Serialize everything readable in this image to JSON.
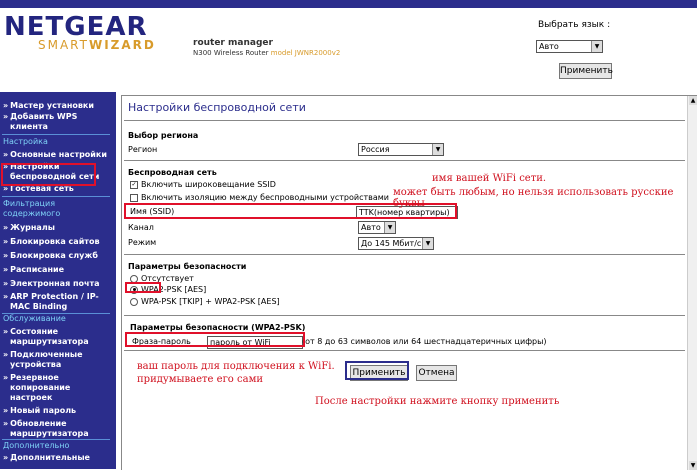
{
  "header": {
    "logo_top": "NETGEAR",
    "logo_smart": "SMART",
    "logo_wizard": "WIZARD",
    "router_manager": "router manager",
    "model_line": "N300 Wireless Router",
    "model_name": "model JWNR2000v2",
    "language_label": "Выбрать язык :",
    "language_value": "Авто",
    "apply_lang_button": "Применить"
  },
  "sidebar": {
    "items": [
      {
        "label": "Мастер установки"
      },
      {
        "label": "Добавить WPS"
      },
      {
        "label": "клиента"
      },
      {
        "label": "Настройка"
      },
      {
        "label": "Основные настройки"
      },
      {
        "label": "Настройки"
      },
      {
        "label": "беспроводной сети"
      },
      {
        "label": "Гостевая сеть"
      },
      {
        "label": "Фильтрация"
      },
      {
        "label": "содержимого"
      },
      {
        "label": "Журналы"
      },
      {
        "label": "Блокировка сайтов"
      },
      {
        "label": "Блокировка служб"
      },
      {
        "label": "Расписание"
      },
      {
        "label": "Электронная почта"
      },
      {
        "label": "ARP Protection / IP-"
      },
      {
        "label": "MAC Binding"
      },
      {
        "label": "Обслуживание"
      },
      {
        "label": "Состояние"
      },
      {
        "label": "маршрутизатора"
      },
      {
        "label": "Подключенные"
      },
      {
        "label": "устройства"
      },
      {
        "label": "Резервное"
      },
      {
        "label": "копирование"
      },
      {
        "label": "настроек"
      },
      {
        "label": "Новый пароль"
      },
      {
        "label": "Обновление"
      },
      {
        "label": "маршрутизатора"
      },
      {
        "label": "Дополнительно"
      },
      {
        "label": "Дополнительные"
      }
    ]
  },
  "main": {
    "title": "Настройки беспроводной сети",
    "region_section": "Выбор региона",
    "region_label": "Регион",
    "region_value": "Россия",
    "wireless_section": "Беспроводная сеть",
    "ssid_broadcast": "Включить широковещание SSID",
    "isolation": "Включить изоляцию между беспроводными устройствами",
    "ssid_label": "Имя (SSID)",
    "ssid_value": "TTK(номер квартиры)",
    "channel_label": "Канал",
    "channel_value": "Авто",
    "mode_label": "Режим",
    "mode_value": "До 145 Мбит/с",
    "security_section": "Параметры безопасности",
    "sec_none": "Отсутствует",
    "sec_wpa2": "WPA2-PSK [AES]",
    "sec_mixed": "WPA-PSK [TKIP] + WPA2-PSK [AES]",
    "wpa2_section": "Параметры безопасности (WPA2-PSK)",
    "passphrase_label": "Фраза-пароль",
    "passphrase_value": "пароль от WiFi",
    "passphrase_hint": "(от 8 до 63 символов или 64 шестнадцатеричных цифры)",
    "apply_button": "Применить",
    "cancel_button": "Отмена"
  },
  "annotations": {
    "ssid_note_1": "имя вашей WiFi сети.",
    "ssid_note_2": "может быть любым, но нельзя использовать русские буквы",
    "pass_note_1": "ваш пароль для подключения к WiFi.",
    "pass_note_2": "придумываете его сами",
    "apply_note": "После настройки нажмите кнопку применить"
  },
  "colors": {
    "sidebar_bg": "#2b2d8c",
    "annotation": "#d0101e",
    "logo_orange": "#d89b2b"
  }
}
